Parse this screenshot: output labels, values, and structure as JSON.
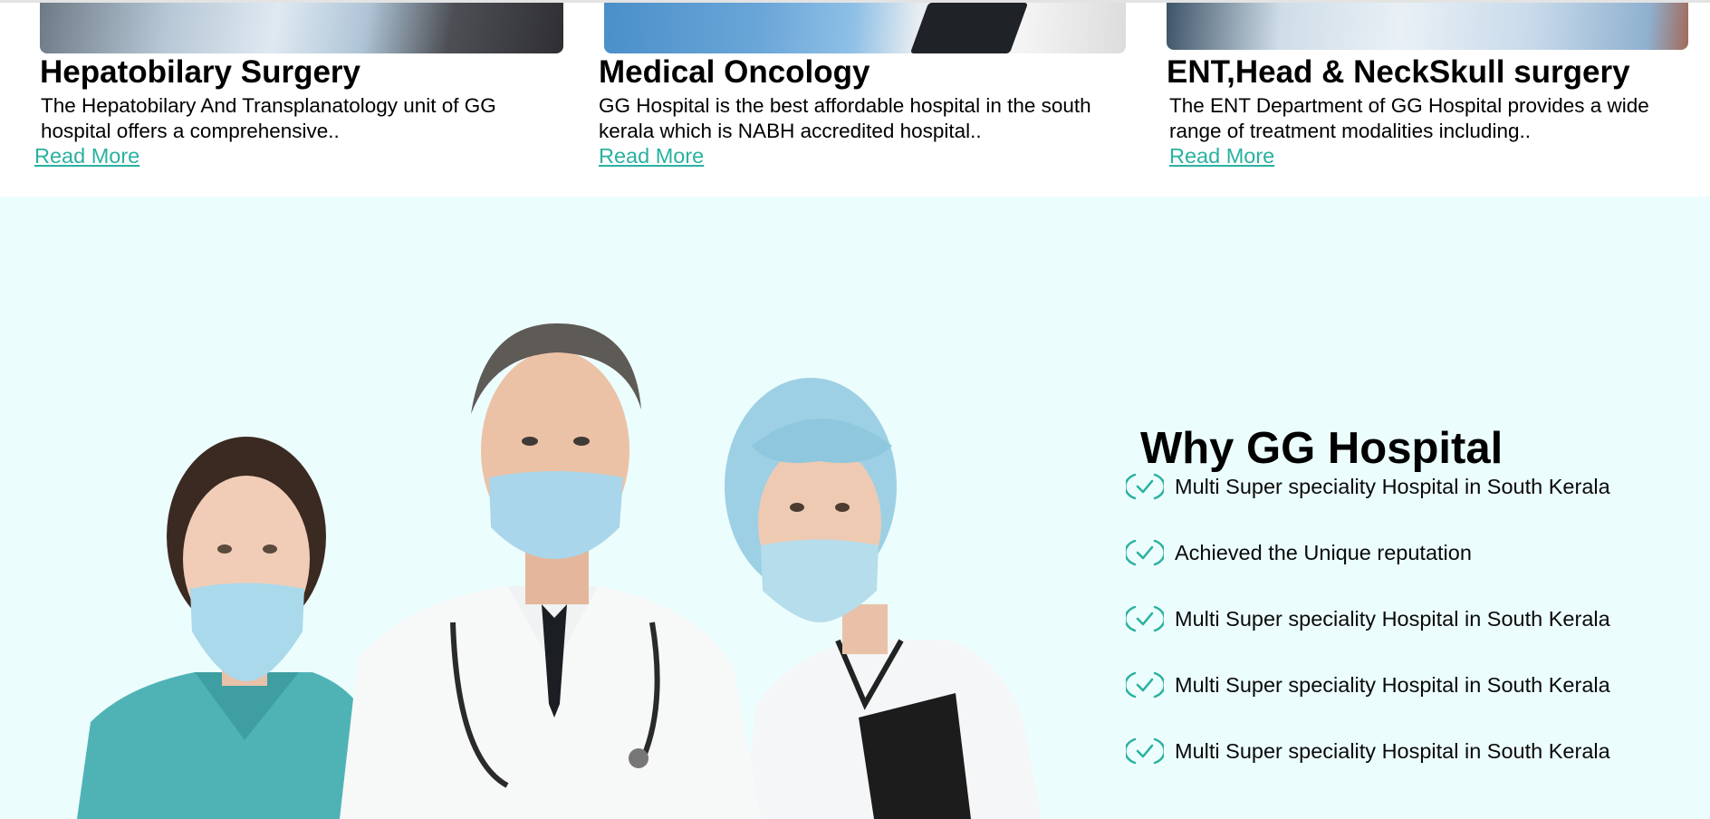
{
  "cards": [
    {
      "title": "Hepatobilary Surgery",
      "description": "The Hepatobilary And Transplanatology unit of GG hospital offers a comprehensive..",
      "link": "Read More"
    },
    {
      "title": "Medical Oncology",
      "description": "GG Hospital is the best affordable hospital in the south kerala which is NABH accredited hospital..",
      "link": "Read More"
    },
    {
      "title": "ENT,Head & NeckSkull surgery",
      "description": "The ENT Department of GG Hospital provides a wide range of treatment modalities including..",
      "link": "Read More"
    }
  ],
  "why": {
    "title": "Why GG Hospital",
    "items": [
      "Multi Super speciality Hospital in South Kerala",
      "Achieved the Unique reputation",
      "Multi Super speciality Hospital in South Kerala",
      "Multi Super speciality Hospital in South Kerala",
      "Multi Super speciality Hospital in South Kerala"
    ],
    "icon": "check-circle-icon"
  },
  "colors": {
    "accent": "#2ab1a0",
    "section_bg": "#ecfdfd"
  }
}
